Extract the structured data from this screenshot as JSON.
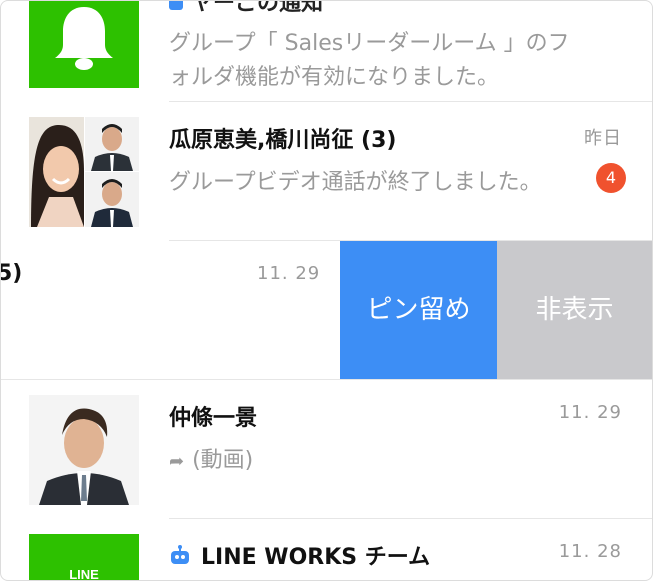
{
  "rows": [
    {
      "title": "ヤーごの通知",
      "preview_line1": "グループ「 Salesリーダールーム 」のフ",
      "preview_line2": "ォルダ機能が有効になりました。"
    },
    {
      "title": "瓜原恵美,橋川尚征 (3)",
      "time": "昨日",
      "preview": "グループビデオ通話が終了しました。",
      "badge": "4"
    },
    {
      "title_fragment": "5)",
      "time": "11. 29",
      "actions": {
        "pin": "ピン留め",
        "hide": "非表示"
      }
    },
    {
      "title": "仲條一景",
      "time": "11. 29",
      "preview": "(動画)"
    },
    {
      "title": "LINE WORKS チーム",
      "time": "11. 28",
      "avatar_text": "LINE"
    }
  ],
  "colors": {
    "green": "#2dc100",
    "pin_blue": "#3d8ef5",
    "hide_gray": "#c9c9cc",
    "badge_red": "#f0522e"
  }
}
